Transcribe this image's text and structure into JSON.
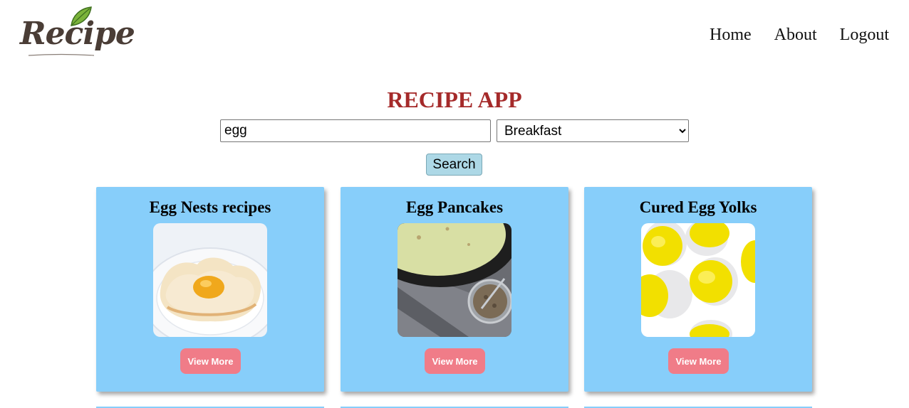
{
  "header": {
    "logo_text": "Recipe",
    "nav": [
      {
        "label": "Home"
      },
      {
        "label": "About"
      },
      {
        "label": "Logout"
      }
    ]
  },
  "main": {
    "title": "RECIPE APP",
    "search": {
      "value": "egg",
      "category_selected": "Breakfast",
      "button_label": "Search"
    }
  },
  "cards": [
    {
      "title": "Egg Nests recipes",
      "button_label": "View More",
      "image": "egg-nest-photo"
    },
    {
      "title": "Egg Pancakes",
      "button_label": "View More",
      "image": "egg-pancake-photo"
    },
    {
      "title": "Cured Egg Yolks",
      "button_label": "View More",
      "image": "cured-egg-yolk-photo"
    }
  ],
  "colors": {
    "title": "#a52a2a",
    "card_bg": "#87cefa",
    "view_more_bg": "#f07c88",
    "search_button_bg": "#add8e6"
  }
}
